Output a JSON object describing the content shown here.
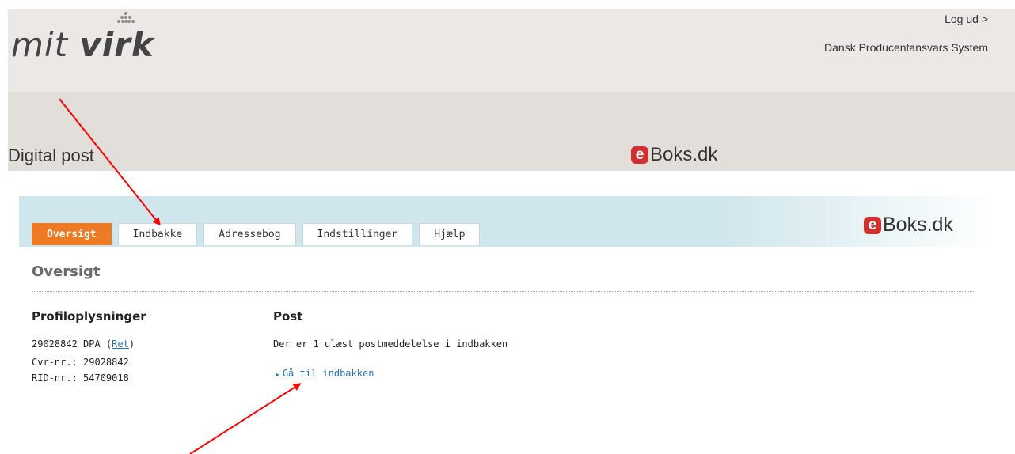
{
  "header": {
    "logo_part1": "mit ",
    "logo_part2": "virk",
    "logout_label": "Log ud >",
    "system_name": "Dansk Producentansvars System",
    "section_title": "Digital post",
    "eboks_logo_e": "e",
    "eboks_logo_text": "Boks.dk"
  },
  "eboks": {
    "logo_e": "e",
    "logo_text": "Boks.dk",
    "tabs": [
      {
        "label": "Oversigt",
        "active": true
      },
      {
        "label": "Indbakke"
      },
      {
        "label": "Adressebog"
      },
      {
        "label": "Indstillinger"
      },
      {
        "label": "Hjælp"
      }
    ]
  },
  "overview": {
    "title": "Oversigt",
    "profile": {
      "title": "Profiloplysninger",
      "line1_text": "29028842 DPA (",
      "line1_link": "Ret",
      "line1_end": ")",
      "cvr": "Cvr-nr.: 29028842",
      "rid": "RID-nr.: 54709018"
    },
    "post": {
      "title": "Post",
      "message": "Der er 1 ulæst postmeddelelse i indbakken",
      "link_label": "Gå til indbakken"
    }
  },
  "colors": {
    "active_tab": "#ef7a24",
    "tab_band": "#cfe6ec",
    "link": "#2472b5",
    "arrow": "#ff0000",
    "eboks_red": "#d32f2f"
  }
}
